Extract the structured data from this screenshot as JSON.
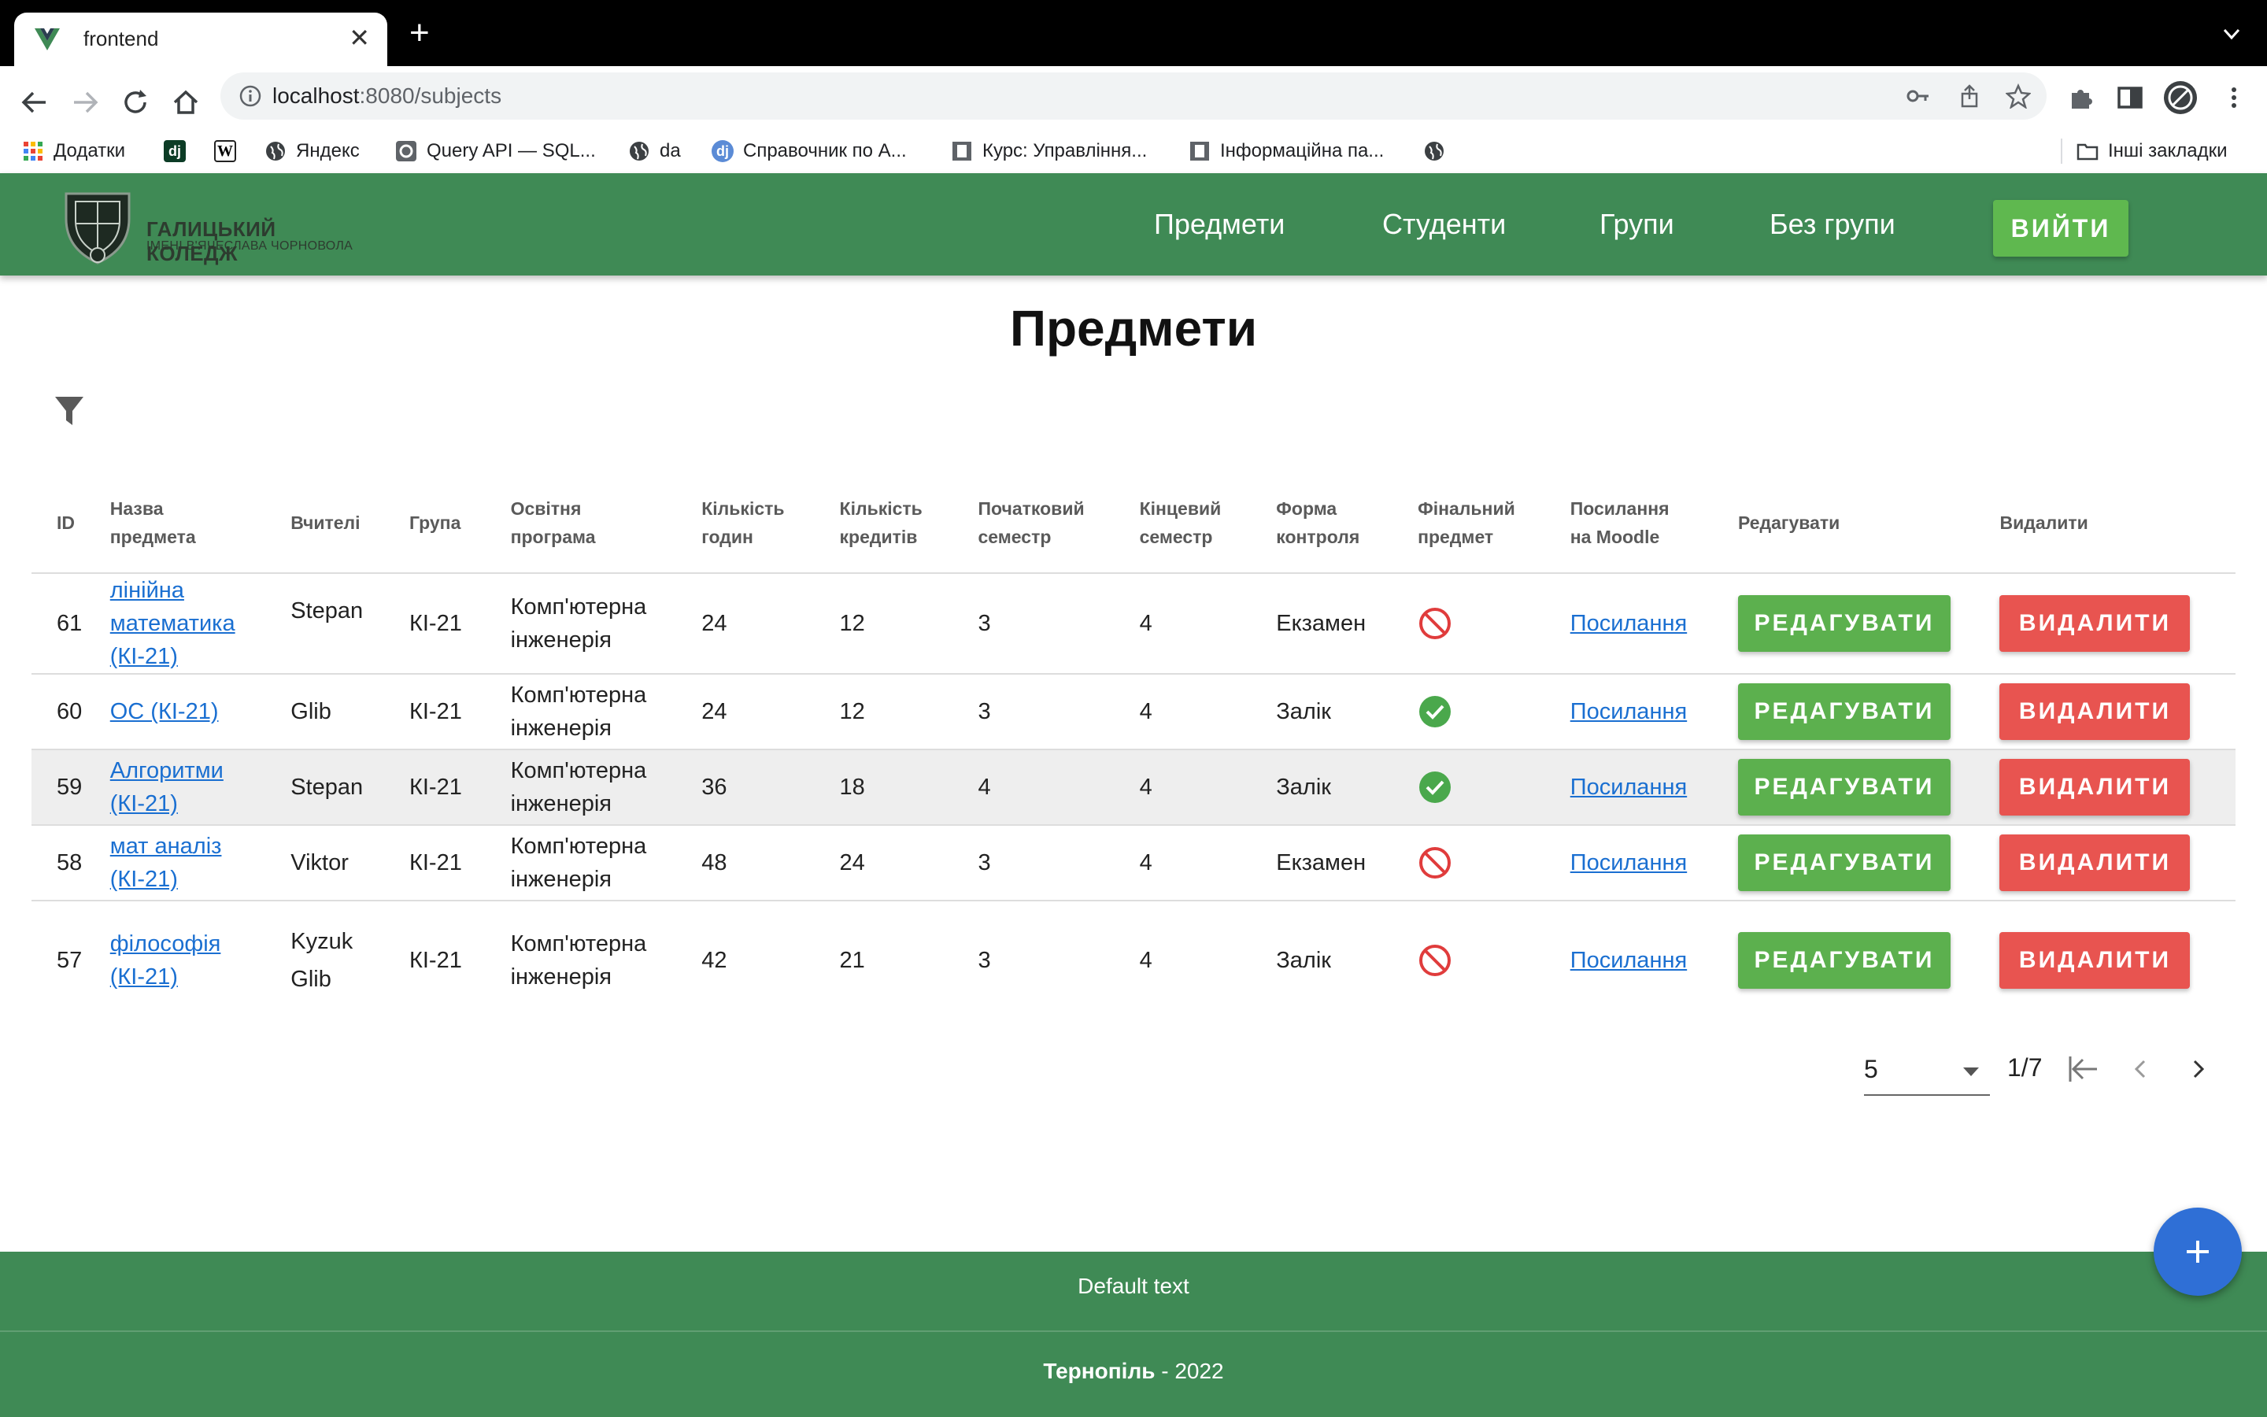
{
  "browser": {
    "tab_title": "frontend",
    "url_host": "localhost",
    "url_rest": ":8080/subjects",
    "bookmarks": [
      {
        "label": "Додатки",
        "icon": "apps-grid-icon"
      },
      {
        "label": "",
        "icon": "dj-icon",
        "text": "dj"
      },
      {
        "label": "",
        "icon": "wikipedia-icon",
        "text": "W"
      },
      {
        "label": "Яндекс",
        "icon": "globe-icon"
      },
      {
        "label": "Query API — SQL...",
        "icon": "query-icon"
      },
      {
        "label": "da",
        "icon": "globe-icon"
      },
      {
        "label": "Справочник по A...",
        "icon": "dj-icon",
        "text": "dj"
      },
      {
        "label": "Курс: Управління...",
        "icon": "moodle-icon"
      },
      {
        "label": "Інформаційна па...",
        "icon": "moodle-icon"
      },
      {
        "label": "",
        "icon": "globe-icon"
      }
    ],
    "other_bookmarks": "Інші закладки"
  },
  "header": {
    "logo_line1": "ГАЛИЦЬКИЙ КОЛЕДЖ",
    "logo_line2": "ІМЕНІ В'ЯЧЕСЛАВА ЧОРНОВОЛА",
    "nav": [
      "Предмети",
      "Студенти",
      "Групи",
      "Без групи"
    ],
    "logout": "вийти"
  },
  "page": {
    "title": "Предмети"
  },
  "table": {
    "headers": {
      "id": "ID",
      "name": "Назва предмета",
      "teachers": "Вчителі",
      "group": "Група",
      "program": "Освітня програма",
      "hours": "Кількість годин",
      "credits": "Кількість кредитів",
      "start": "Початковий семестр",
      "end": "Кінцевий семестр",
      "control": "Форма контроля",
      "final": "Фінальний предмет",
      "moodle": "Посилання на Moodle",
      "edit": "Редагувати",
      "delete": "Видалити"
    },
    "rows": [
      {
        "id": "61",
        "name": "лінійна математика (КІ-21)",
        "teachers": "Stepan",
        "group": "КІ-21",
        "program": "Комп'ютерна інженерія",
        "hours": "24",
        "credits": "12",
        "start": "3",
        "end": "4",
        "control": "Екзамен",
        "final": false,
        "moodle": "Посилання",
        "edit": "редагувати",
        "delete": "видалити"
      },
      {
        "id": "60",
        "name": "ОС (КІ-21)",
        "teachers": "Glib",
        "group": "КІ-21",
        "program": "Комп'ютерна інженерія",
        "hours": "24",
        "credits": "12",
        "start": "3",
        "end": "4",
        "control": "Залік",
        "final": true,
        "moodle": "Посилання",
        "edit": "редагувати",
        "delete": "видалити"
      },
      {
        "id": "59",
        "name": "Алгоритми (КІ-21)",
        "teachers": "Stepan",
        "group": "КІ-21",
        "program": "Комп'ютерна інженерія",
        "hours": "36",
        "credits": "18",
        "start": "4",
        "end": "4",
        "control": "Залік",
        "final": true,
        "moodle": "Посилання",
        "edit": "редагувати",
        "delete": "видалити"
      },
      {
        "id": "58",
        "name": "мат аналіз (КІ-21)",
        "teachers": "Viktor",
        "group": "КІ-21",
        "program": "Комп'ютерна інженерія",
        "hours": "48",
        "credits": "24",
        "start": "3",
        "end": "4",
        "control": "Екзамен",
        "final": false,
        "moodle": "Посилання",
        "edit": "редагувати",
        "delete": "видалити"
      },
      {
        "id": "57",
        "name": "філософія (КІ-21)",
        "teachers": "Kyzuk",
        "teachers2": "Glib",
        "group": "КІ-21",
        "program": "Комп'ютерна інженерія",
        "hours": "42",
        "credits": "21",
        "start": "3",
        "end": "4",
        "control": "Залік",
        "final": false,
        "moodle": "Посилання",
        "edit": "редагувати",
        "delete": "видалити"
      }
    ]
  },
  "pagination": {
    "per_page": "5",
    "page_info": "1/7"
  },
  "footer": {
    "text": "Default text",
    "city": "Тернопіль",
    "year": " - 2022"
  },
  "colors": {
    "brand_green": "#3f8a55",
    "edit_green": "#5cb04e",
    "delete_red": "#e85450",
    "fab_blue": "#2f6fd6",
    "link_blue": "#1a6fd1"
  }
}
